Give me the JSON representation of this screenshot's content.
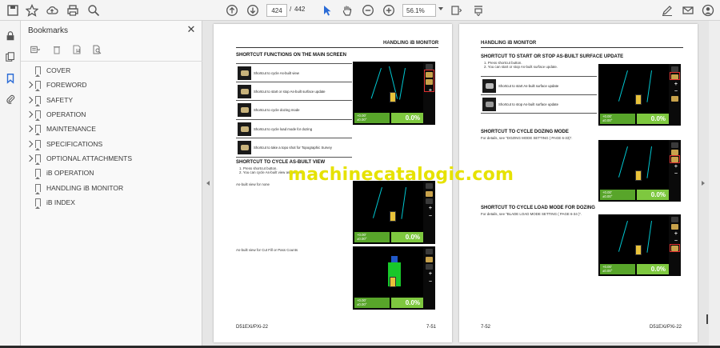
{
  "toolbar": {
    "current_page": "424",
    "separator": "/",
    "total_pages": "442",
    "zoom": "56.1%"
  },
  "bookmarks": {
    "title": "Bookmarks",
    "items": [
      {
        "label": "COVER",
        "expandable": false
      },
      {
        "label": "FOREWORD",
        "expandable": true
      },
      {
        "label": "SAFETY",
        "expandable": true
      },
      {
        "label": "OPERATION",
        "expandable": true
      },
      {
        "label": "MAINTENANCE",
        "expandable": true
      },
      {
        "label": "SPECIFICATIONS",
        "expandable": true
      },
      {
        "label": "OPTIONAL ATTACHMENTS",
        "expandable": true
      },
      {
        "label": "iB OPERATION",
        "expandable": false
      },
      {
        "label": "HANDLING iB MONITOR",
        "expandable": false
      },
      {
        "label": "iB INDEX",
        "expandable": false
      }
    ]
  },
  "left_page": {
    "header": "HANDLING iB MONITOR",
    "section1_title": "SHORTCUT FUNCTIONS ON THE MAIN SCREEN",
    "shortcuts": [
      "Shortcut to cycle As-built view",
      "Shortcut to start or stop As-built surface update",
      "Shortcut to cycle dozing mode",
      "Shortcut to cycle load mode for dozing",
      "Shortcut to take a topo shot for Topographic Survey"
    ],
    "section2_title": "SHORTCUT TO CYCLE AS-BUILT VIEW",
    "section2_steps": [
      "1. Press shortcut button.",
      "2. You can cycle As-built view as follows."
    ],
    "caption1": "As-built view for none",
    "caption2": "As-built view for Cut Fill or Pass Counts",
    "footer_left": "D51EXi/PXi-22",
    "footer_right": "7-51"
  },
  "right_page": {
    "header": "HANDLING iB MONITOR",
    "section1_title": "SHORTCUT TO START OR STOP AS-BUILT SURFACE UPDATE",
    "section1_steps": [
      "1. Press shortcut button.",
      "2. You can start or stop As-built surface update."
    ],
    "shortcuts": [
      "Shortcut to start As-built surface update",
      "Shortcut to stop As-built surface update"
    ],
    "section2_title": "SHORTCUT TO CYCLE DOZING MODE",
    "section2_text": "For details, see \"DOZING MODE SETTING ( PAGE 6-33)\".",
    "section3_title": "SHORTCUT TO CYCLE LOAD MODE FOR DOZING",
    "section3_text": "For details, see \"BLADE LOAD MODE SETTING ( PAGE 6-34 )\".",
    "footer_left": "7-52",
    "footer_right": "D51EXi/PXi-22"
  },
  "screen": {
    "readout_top": "+0.00'",
    "readout_bottom": "±0.00°",
    "percent": "0.0%"
  },
  "watermark": "machinecatalogic.com",
  "colors": {
    "screen_bg": "#000000",
    "readout_green": "#58a52a",
    "percent_green": "#7ec83f",
    "highlight_red": "#e03030",
    "watermark_yellow": "#e6e200"
  }
}
